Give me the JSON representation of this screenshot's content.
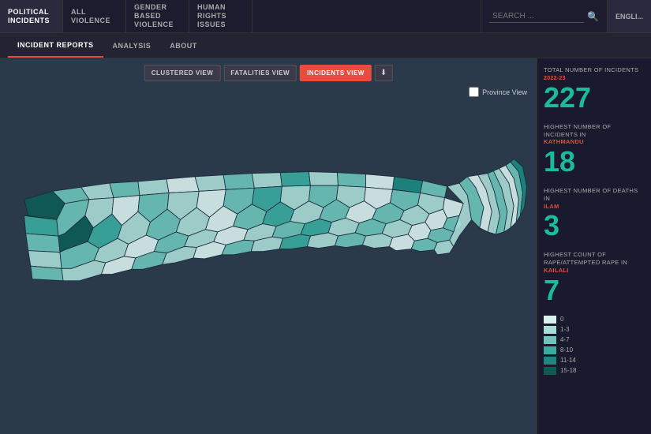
{
  "nav": {
    "items": [
      {
        "id": "political",
        "label": "POLITICAL INCIDENTS"
      },
      {
        "id": "all-violence",
        "label": "ALL VIOLENCE"
      },
      {
        "id": "gender-violence",
        "label": "GENDER BASED VIOLENCE"
      },
      {
        "id": "human-rights",
        "label": "HUMAN RIGHTS ISSUES"
      },
      {
        "id": "incident-reports",
        "label": "INCIDENT REPORTS"
      },
      {
        "id": "analysis",
        "label": "ANALYSIS"
      },
      {
        "id": "about",
        "label": "ABOUT"
      }
    ],
    "search_placeholder": "SEARCH ...",
    "lang_label": "ENGLI..."
  },
  "second_nav": {
    "items": [
      {
        "id": "incident-reports",
        "label": "INCIDENT REPORTS",
        "active": true
      },
      {
        "id": "analysis",
        "label": "ANALYSIS"
      },
      {
        "id": "about",
        "label": "ABOUT"
      }
    ]
  },
  "view_controls": {
    "clustered_label": "CLUSTERED VIEW",
    "fatalities_label": "FATALITIES VIEW",
    "incidents_label": "INCIDENTS VIEW"
  },
  "province_view": {
    "label": "Province View"
  },
  "sidebar": {
    "total_incidents_label": "TOTAL NUMBER OF INCIDENTS",
    "year_range": "2022-23",
    "total_incidents": "227",
    "highest_incidents_label": "HIGHEST NUMBER OF INCIDENTS IN",
    "highest_incidents_place": "KATHMANDU",
    "highest_incidents_count": "18",
    "highest_deaths_label": "HIGHEST NUMBER OF DEATHS IN",
    "highest_deaths_place": "ILAM",
    "highest_deaths_count": "3",
    "highest_rape_label": "HIGHEST COUNT OF RAPE/ATTEMPTED RAPE IN",
    "highest_rape_place": "KAILALI",
    "highest_rape_count": "7"
  },
  "legend": {
    "items": [
      {
        "color": "#d9f0ed",
        "label": "0"
      },
      {
        "color": "#a8dcd6",
        "label": "1-3"
      },
      {
        "color": "#6cc4ba",
        "label": "4-7"
      },
      {
        "color": "#3aab9f",
        "label": "8-10"
      },
      {
        "color": "#1a8a7f",
        "label": "11-14"
      },
      {
        "color": "#0d5c54",
        "label": "15-18"
      }
    ]
  },
  "map": {
    "background_color": "#2a3a4a"
  }
}
